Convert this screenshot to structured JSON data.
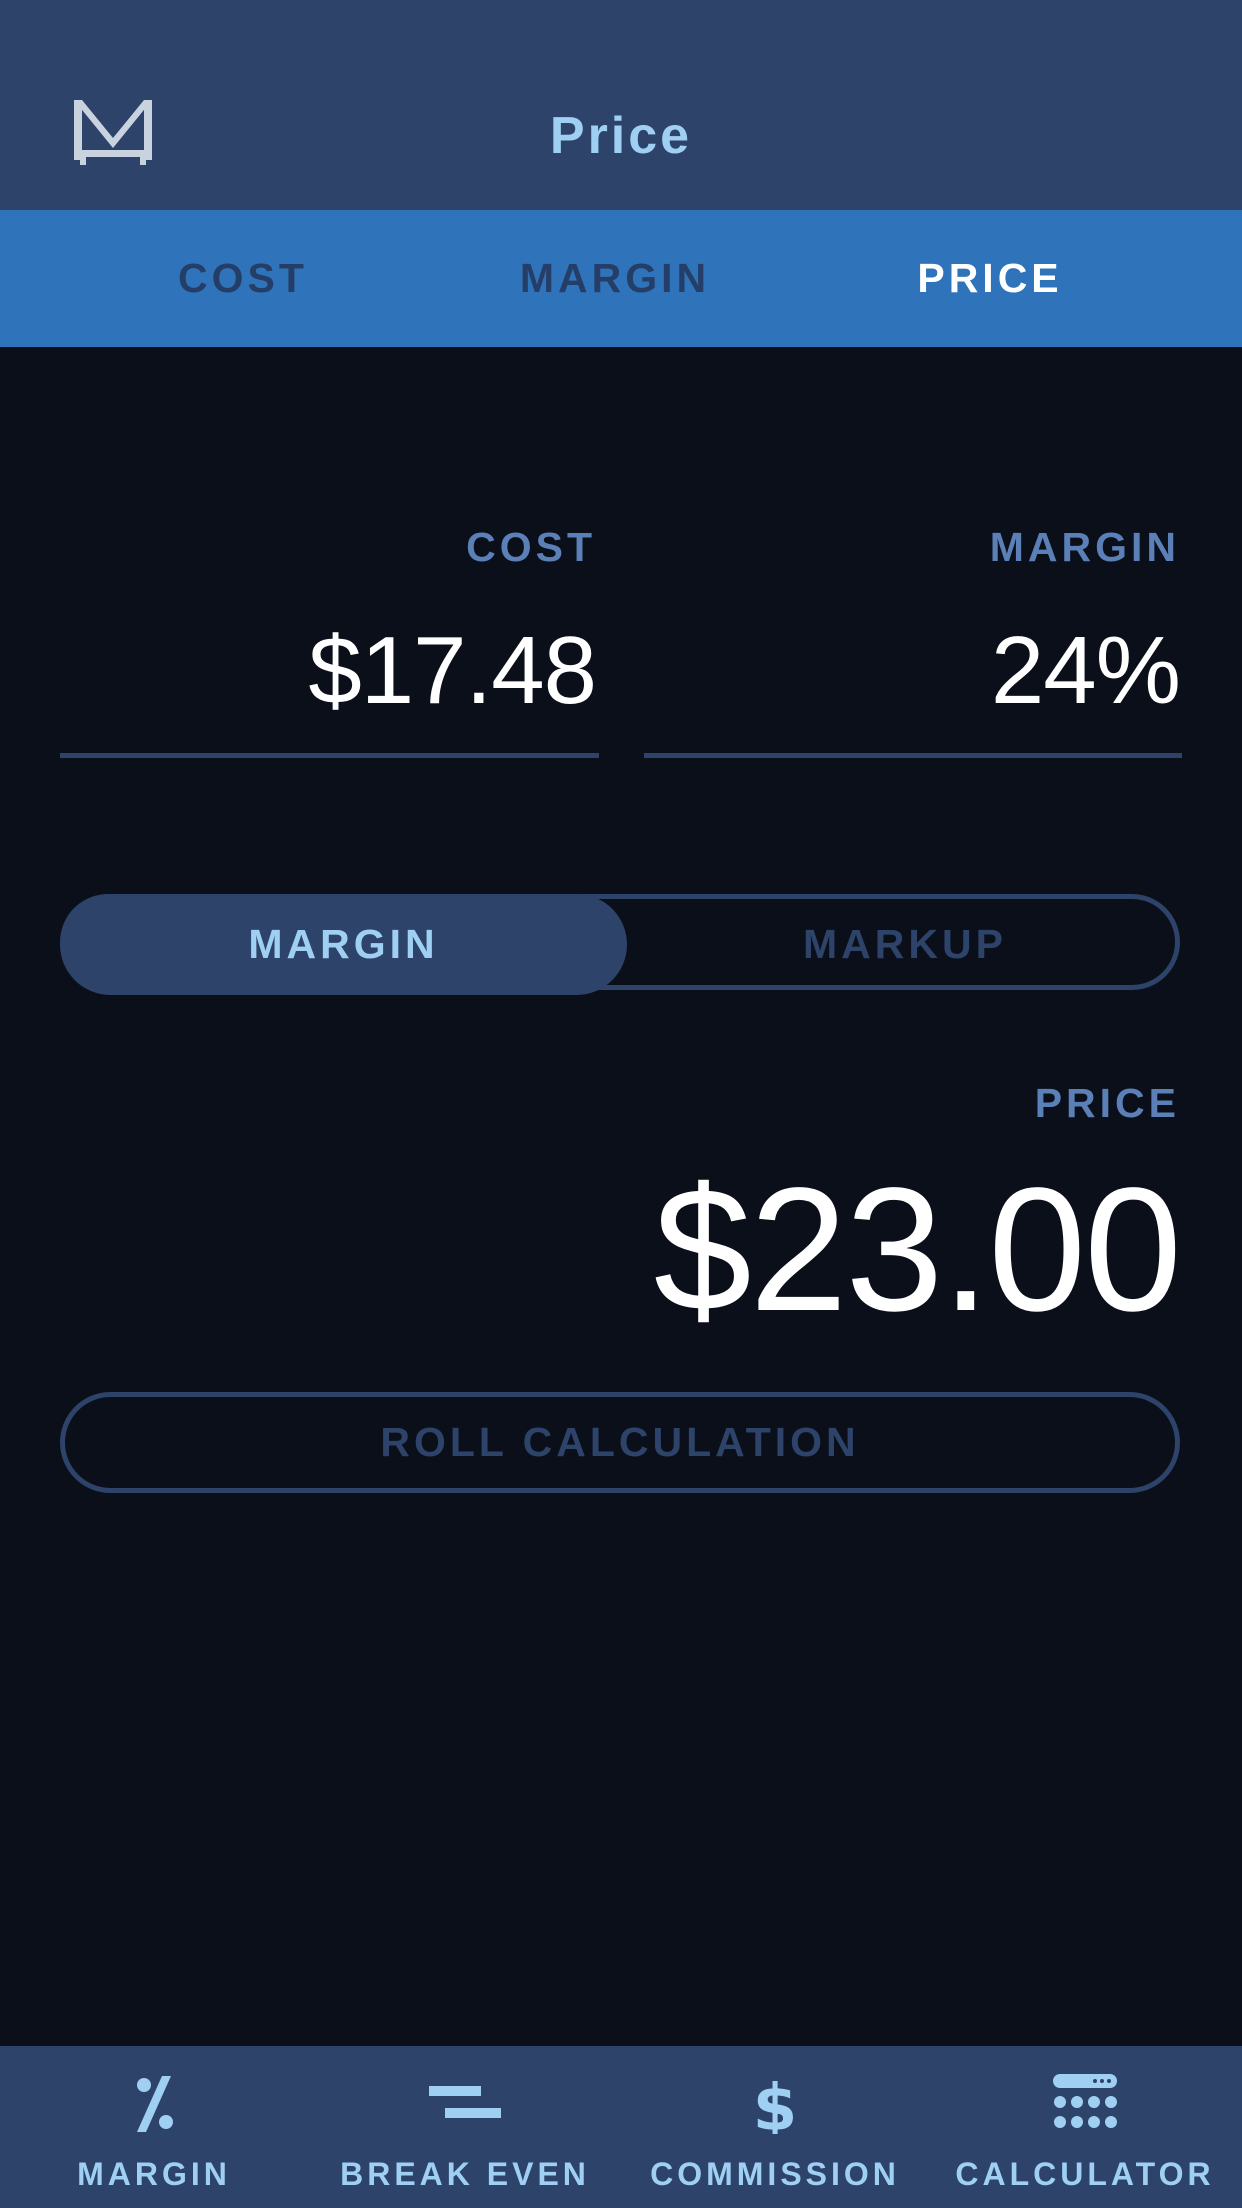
{
  "header": {
    "title": "Price",
    "logo_icon": "m-logo-icon"
  },
  "tabs": [
    {
      "label": "COST",
      "active": false
    },
    {
      "label": "MARGIN",
      "active": false
    },
    {
      "label": "PRICE",
      "active": true
    }
  ],
  "inputs": {
    "cost": {
      "label": "COST",
      "value": "$17.48"
    },
    "margin": {
      "label": "MARGIN",
      "value": "24%"
    }
  },
  "toggle": {
    "options": [
      "MARGIN",
      "MARKUP"
    ],
    "selected": "MARGIN"
  },
  "result": {
    "label": "PRICE",
    "value": "$23.00"
  },
  "roll_button": {
    "label": "ROLL CALCULATION"
  },
  "bottom_nav": [
    {
      "label": "MARGIN",
      "icon": "percent-icon"
    },
    {
      "label": "BREAK EVEN",
      "icon": "break-even-icon"
    },
    {
      "label": "COMMISSION",
      "icon": "dollar-icon"
    },
    {
      "label": "CALCULATOR",
      "icon": "calculator-icon"
    }
  ],
  "colors": {
    "background": "#0a0f1a",
    "header_bg": "#2d4369",
    "tab_bar_bg": "#2f74bb",
    "accent_light": "#9fd0f3",
    "label_blue": "#5b7fb7"
  }
}
